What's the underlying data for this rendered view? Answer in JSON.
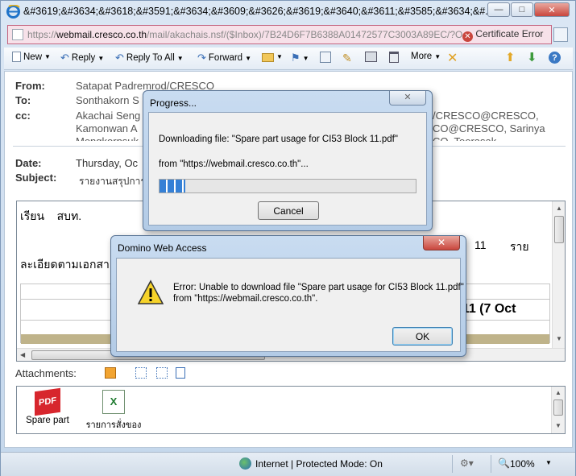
{
  "window": {
    "title": "&#3619;&#3634;&#3618;&#3591;&#3634;&#3609;&#3626;&#3619;&#3640;&#3611;&#3585;&#3634;&#...",
    "url_prefix": "https://",
    "url_domain": "webmail.cresco.co.th",
    "url_rest": "/mail/akachais.nsf/($Inbox)/7B24D6F7B6388A01472577C3003A89EC/?Op",
    "cert_error": "Certificate Error"
  },
  "toolbar": {
    "new": "New",
    "reply": "Reply",
    "reply_all": "Reply To All",
    "forward": "Forward",
    "more": "More"
  },
  "message": {
    "from_label": "From:",
    "from": "Satapat Padremrod/CRESCO",
    "to_label": "To:",
    "to": "Sonthakorn S",
    "cc_label": "cc:",
    "cc_line1": "Akachai Seng",
    "cc_line1_right": "/CRESCO@CRESCO,",
    "cc_line2": "Kamonwan A",
    "cc_line2_right": "CO@CRESCO, Sarinya",
    "cc_line3": "Mengkornsuk",
    "cc_line3_right": "CO, Teerasak",
    "date_label": "Date:",
    "date": "Thursday, Oc",
    "subject_label": "Subject:",
    "subject": "รายงานสรุปการ",
    "body_line1": "เรียน    สบท.",
    "body_num": "11",
    "body_rai": "ราย",
    "body_line2": "ละเอียดตามเอกสา",
    "body_bold": "ck11 (7 Oct"
  },
  "attachments": {
    "label": "Attachments:",
    "items": [
      {
        "name": "Spare part",
        "icon": "pdf-icon"
      },
      {
        "name": "รายการสั่งของ",
        "icon": "excel-icon"
      }
    ]
  },
  "status": {
    "zone": "Internet | Protected Mode: On",
    "zoom": "100%"
  },
  "progress_dialog": {
    "title": "Progress...",
    "line1": "Downloading file: \"Spare part usage for CI53 Block 11.pdf\"",
    "line2": "from \"https://webmail.cresco.co.th\"...",
    "progress": 0.1,
    "cancel": "Cancel"
  },
  "error_dialog": {
    "title": "Domino Web Access",
    "line1": "Error: Unable to download file \"Spare part usage for CI53 Block 11.pdf\"",
    "line2": "from \"https://webmail.cresco.co.th\".",
    "ok": "OK"
  },
  "colors": {
    "accent": "#2f6fbe",
    "close_red": "#c9463d",
    "address_bar_error": "#f7e1e9"
  }
}
